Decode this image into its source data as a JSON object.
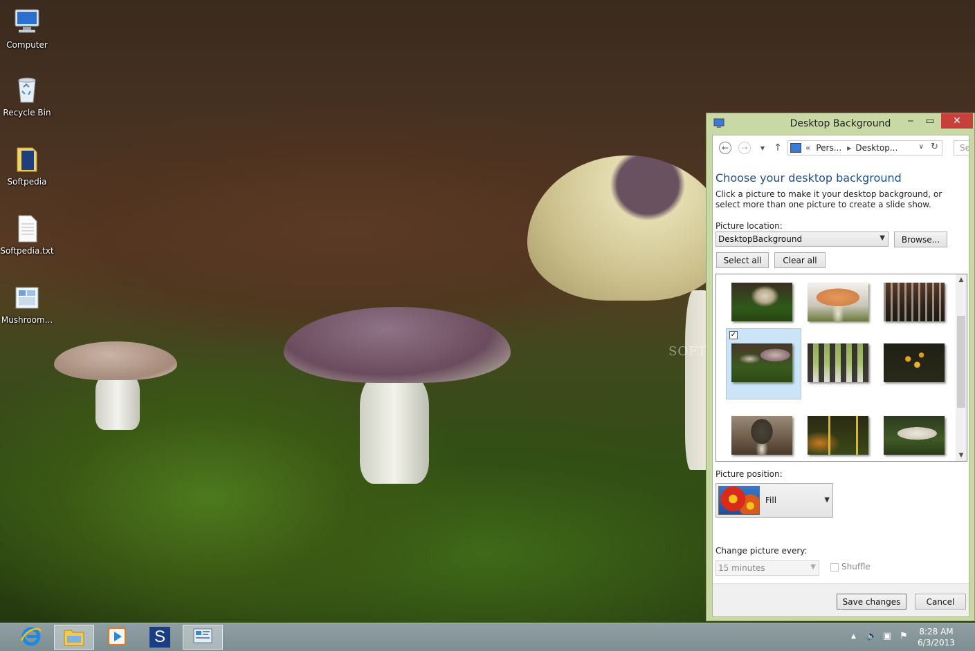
{
  "desktop": {
    "icons": [
      {
        "label": "Computer",
        "icon": "computer-icon"
      },
      {
        "label": "Recycle Bin",
        "icon": "recycle-bin-icon"
      },
      {
        "label": "Softpedia",
        "icon": "folder-icon"
      },
      {
        "label": "Softpedia.txt",
        "icon": "text-file-icon"
      },
      {
        "label": "Mushroom...",
        "icon": "theme-file-icon"
      }
    ],
    "watermark": "SOFTPEDIA"
  },
  "window": {
    "title": "Desktop Background",
    "nav": {
      "breadcrumb_sep": "«",
      "crumb1": "Pers...",
      "crumb2": "Desktop...",
      "search_placeholder": "Sea"
    },
    "heading": "Choose your desktop background",
    "description": "Click a picture to make it your desktop background, or select more than one picture to create a slide show.",
    "picture_location_label": "Picture location:",
    "picture_location_value": "DesktopBackground",
    "browse_label": "Browse...",
    "select_all_label": "Select all",
    "clear_all_label": "Clear all",
    "thumbnails": [
      {
        "name": "Mushroom group on moss",
        "checked": false
      },
      {
        "name": "Orange cap mushroom",
        "checked": false
      },
      {
        "name": "Dark fungi cluster",
        "checked": false
      },
      {
        "name": "Russula mushrooms",
        "checked": true
      },
      {
        "name": "Ink cap mushrooms",
        "checked": false
      },
      {
        "name": "Orange fungus balls",
        "checked": false
      },
      {
        "name": "Morel mushroom",
        "checked": false
      },
      {
        "name": "Yellow coral fungi",
        "checked": false
      },
      {
        "name": "White mushrooms",
        "checked": false
      }
    ],
    "picture_position_label": "Picture position:",
    "picture_position_value": "Fill",
    "change_every_label": "Change picture every:",
    "change_every_value": "15 minutes",
    "shuffle_label": "Shuffle",
    "save_label": "Save changes",
    "cancel_label": "Cancel"
  },
  "taskbar": {
    "apps": [
      "internet-explorer-icon",
      "file-explorer-icon",
      "media-player-icon",
      "softpedia-s-icon",
      "control-panel-icon"
    ],
    "time": "8:28 AM",
    "date": "6/3/2013"
  }
}
